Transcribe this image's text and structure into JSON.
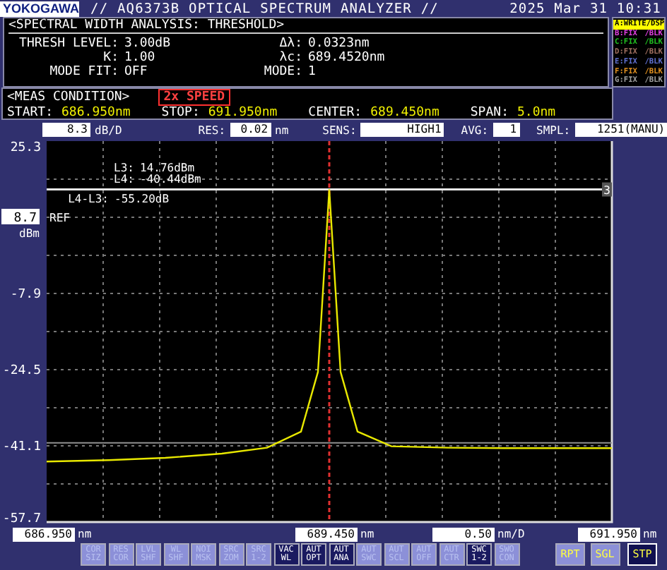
{
  "header": {
    "logo": "YOKOGAWA",
    "title": "// AQ6373B OPTICAL SPECTRUM ANALYZER //",
    "datetime": "2025 Mar 31 10:31"
  },
  "analysis": {
    "title": "<SPECTRAL WIDTH ANALYSIS: THRESHOLD>",
    "rows": [
      {
        "label": "THRESH LEVEL:",
        "value": "3.00dB",
        "label_2": "Δλ:",
        "value_2": "0.0323nm"
      },
      {
        "label": "K:",
        "value": "1.00",
        "label_2": "λc:",
        "value_2": "689.4520nm"
      },
      {
        "label": "MODE FIT:",
        "value": "OFF",
        "label_2": "MODE:",
        "value_2": "1"
      }
    ]
  },
  "trace_list": [
    {
      "label": "A:WRITE",
      "mode": "/DSP",
      "color": "#ffff00",
      "active": true
    },
    {
      "label": "B:FIX",
      "mode": "/BLK",
      "color": "#e040e0",
      "active": false
    },
    {
      "label": "C:FIX",
      "mode": "/BLK",
      "color": "#20c020",
      "active": false
    },
    {
      "label": "D:FIX",
      "mode": "/BLK",
      "color": "#a07060",
      "active": false
    },
    {
      "label": "E:FIX",
      "mode": "/BLK",
      "color": "#6070d0",
      "active": false
    },
    {
      "label": "F:FIX",
      "mode": "/BLK",
      "color": "#e09020",
      "active": false
    },
    {
      "label": "G:FIX",
      "mode": "/BLK",
      "color": "#a0a0a0",
      "active": false
    }
  ],
  "meas_condition": {
    "title": "<MEAS CONDITION>",
    "badge": "2x SPEED",
    "fields": [
      {
        "label": "START:",
        "value": "686.950nm"
      },
      {
        "label": "STOP:",
        "value": "691.950nm"
      },
      {
        "label": "CENTER:",
        "value": "689.450nm"
      },
      {
        "label": "SPAN:",
        "value": "5.0nm"
      }
    ]
  },
  "graph_settings": [
    {
      "value": "8.3",
      "unit": "dB/D"
    },
    {
      "label": "RES:",
      "value": "0.02",
      "unit": "nm"
    },
    {
      "label": "SENS:",
      "value": "HIGH1"
    },
    {
      "label": "AVG:",
      "value": "1"
    },
    {
      "label": "SMPL:",
      "value": "1251(MANU)"
    }
  ],
  "graph": {
    "ref_level": {
      "value": "8.7",
      "label": "REF",
      "unit": "dBm"
    },
    "markers": [
      {
        "label": "L3:",
        "value": "14.76dBm"
      },
      {
        "label": "L4:",
        "value": "-40.44dBm"
      },
      {
        "label": "L4-L3:",
        "value": "-55.20dB"
      }
    ],
    "marker_tag": "3",
    "chart_data": {
      "type": "line",
      "grid": true,
      "x": [
        686.95,
        687.5,
        688.0,
        688.5,
        688.9,
        689.2,
        689.35,
        689.45,
        689.55,
        689.7,
        690.0,
        690.5,
        691.0,
        691.5,
        691.95
      ],
      "series": [
        {
          "color": "#e8e800",
          "values": [
            -44.5,
            -44.2,
            -43.7,
            -42.8,
            -41.5,
            -38,
            -25,
            14.8,
            -25,
            -38,
            -41.2,
            -41.5,
            -41.6,
            -41.6,
            -41.6
          ]
        }
      ],
      "ref_lines": [
        {
          "axis": "y",
          "value": 14.76,
          "color": "#e8e8e8"
        },
        {
          "axis": "y",
          "value": -40.44,
          "color": "#909090"
        },
        {
          "axis": "x",
          "value": 689.45,
          "color": "#e03030"
        }
      ],
      "xlim": [
        686.95,
        691.95
      ],
      "ylim": [
        -57.7,
        25.3
      ],
      "yticks": [
        25.3,
        -7.9,
        -24.5,
        -41.1,
        -57.7
      ],
      "xticks": [
        {
          "value": 686.95,
          "label": "686.950"
        },
        {
          "value": 689.45,
          "label": "689.450"
        },
        {
          "value": 691.95,
          "label": "691.950"
        }
      ]
    },
    "x_units": [
      "nm",
      "nm",
      "nm"
    ],
    "x_scale": {
      "value": "0.50",
      "unit": "nm/D"
    }
  },
  "softkeys": [
    {
      "lines": [
        "COR",
        "SIZ"
      ],
      "disabled": true,
      "selected": false
    },
    {
      "lines": [
        "RES",
        "COR"
      ],
      "disabled": true,
      "selected": false
    },
    {
      "lines": [
        "LVL",
        "SHF"
      ],
      "disabled": true,
      "selected": false
    },
    {
      "lines": [
        "WL",
        "SHF"
      ],
      "disabled": true,
      "selected": false
    },
    {
      "lines": [
        "NOI",
        "MSK"
      ],
      "disabled": true,
      "selected": false
    },
    {
      "lines": [
        "SRC",
        "ZOM"
      ],
      "disabled": true,
      "selected": false
    },
    {
      "lines": [
        "SRC",
        "1-2"
      ],
      "disabled": true,
      "selected": false
    },
    {
      "lines": [
        "VAC",
        "WL"
      ],
      "disabled": false,
      "selected": false
    },
    {
      "lines": [
        "AUT",
        "OPT"
      ],
      "disabled": false,
      "selected": false
    },
    {
      "lines": [
        "AUT",
        "ANA"
      ],
      "disabled": false,
      "selected": false
    },
    {
      "lines": [
        "AUT",
        "SWC"
      ],
      "disabled": true,
      "selected": false
    },
    {
      "lines": [
        "AUT",
        "SCL"
      ],
      "disabled": true,
      "selected": false
    },
    {
      "lines": [
        "AUT",
        "OFF"
      ],
      "disabled": true,
      "selected": false
    },
    {
      "lines": [
        "AUT",
        "CTR"
      ],
      "disabled": true,
      "selected": false
    },
    {
      "lines": [
        "SWC",
        "1-2"
      ],
      "disabled": false,
      "selected": false
    },
    {
      "lines": [
        "SWO",
        "CON"
      ],
      "disabled": true,
      "selected": false
    },
    {
      "lines": [
        "RPT"
      ],
      "disabled": false,
      "selected": false
    },
    {
      "lines": [
        "SGL"
      ],
      "disabled": false,
      "selected": false
    },
    {
      "lines": [
        "STP"
      ],
      "disabled": false,
      "selected": true
    }
  ]
}
